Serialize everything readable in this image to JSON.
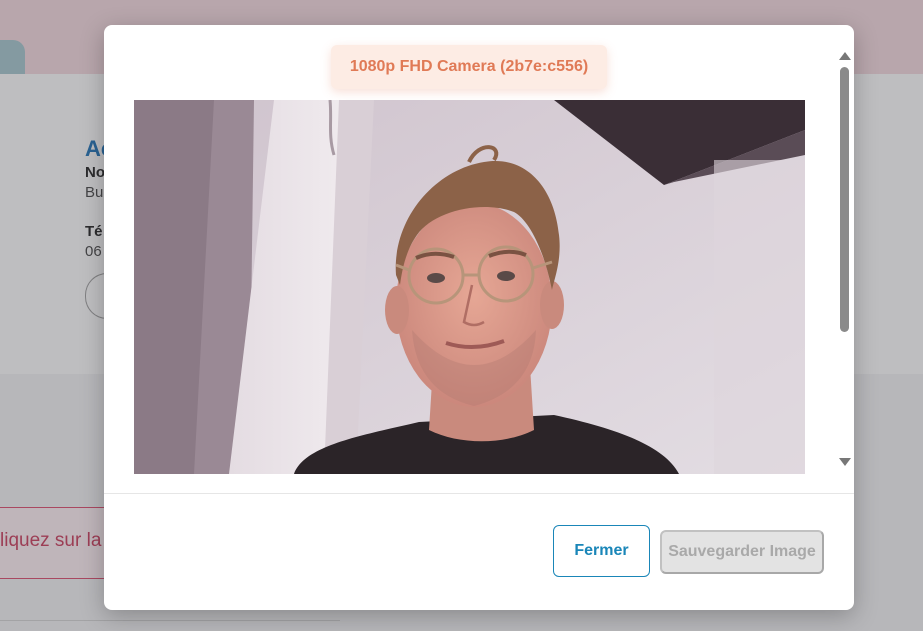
{
  "background": {
    "name_partial": "Ac",
    "field1_label": "No",
    "field1_value": "Bu",
    "field2_label": "Té",
    "field2_value": "06",
    "hint_text": "liquez sur la"
  },
  "modal": {
    "camera_label": "1080p FHD Camera (2b7e:c556)",
    "close_label": "Fermer",
    "save_label": "Sauvegarder Image"
  },
  "colors": {
    "badge_text": "#e07a56",
    "badge_bg": "#fdece4",
    "primary": "#1a86b8",
    "disabled_bg": "#e3e3e3",
    "hint_red": "#c23b5a"
  },
  "icons": {
    "scroll_up": "triangle-up",
    "scroll_down": "triangle-down"
  }
}
